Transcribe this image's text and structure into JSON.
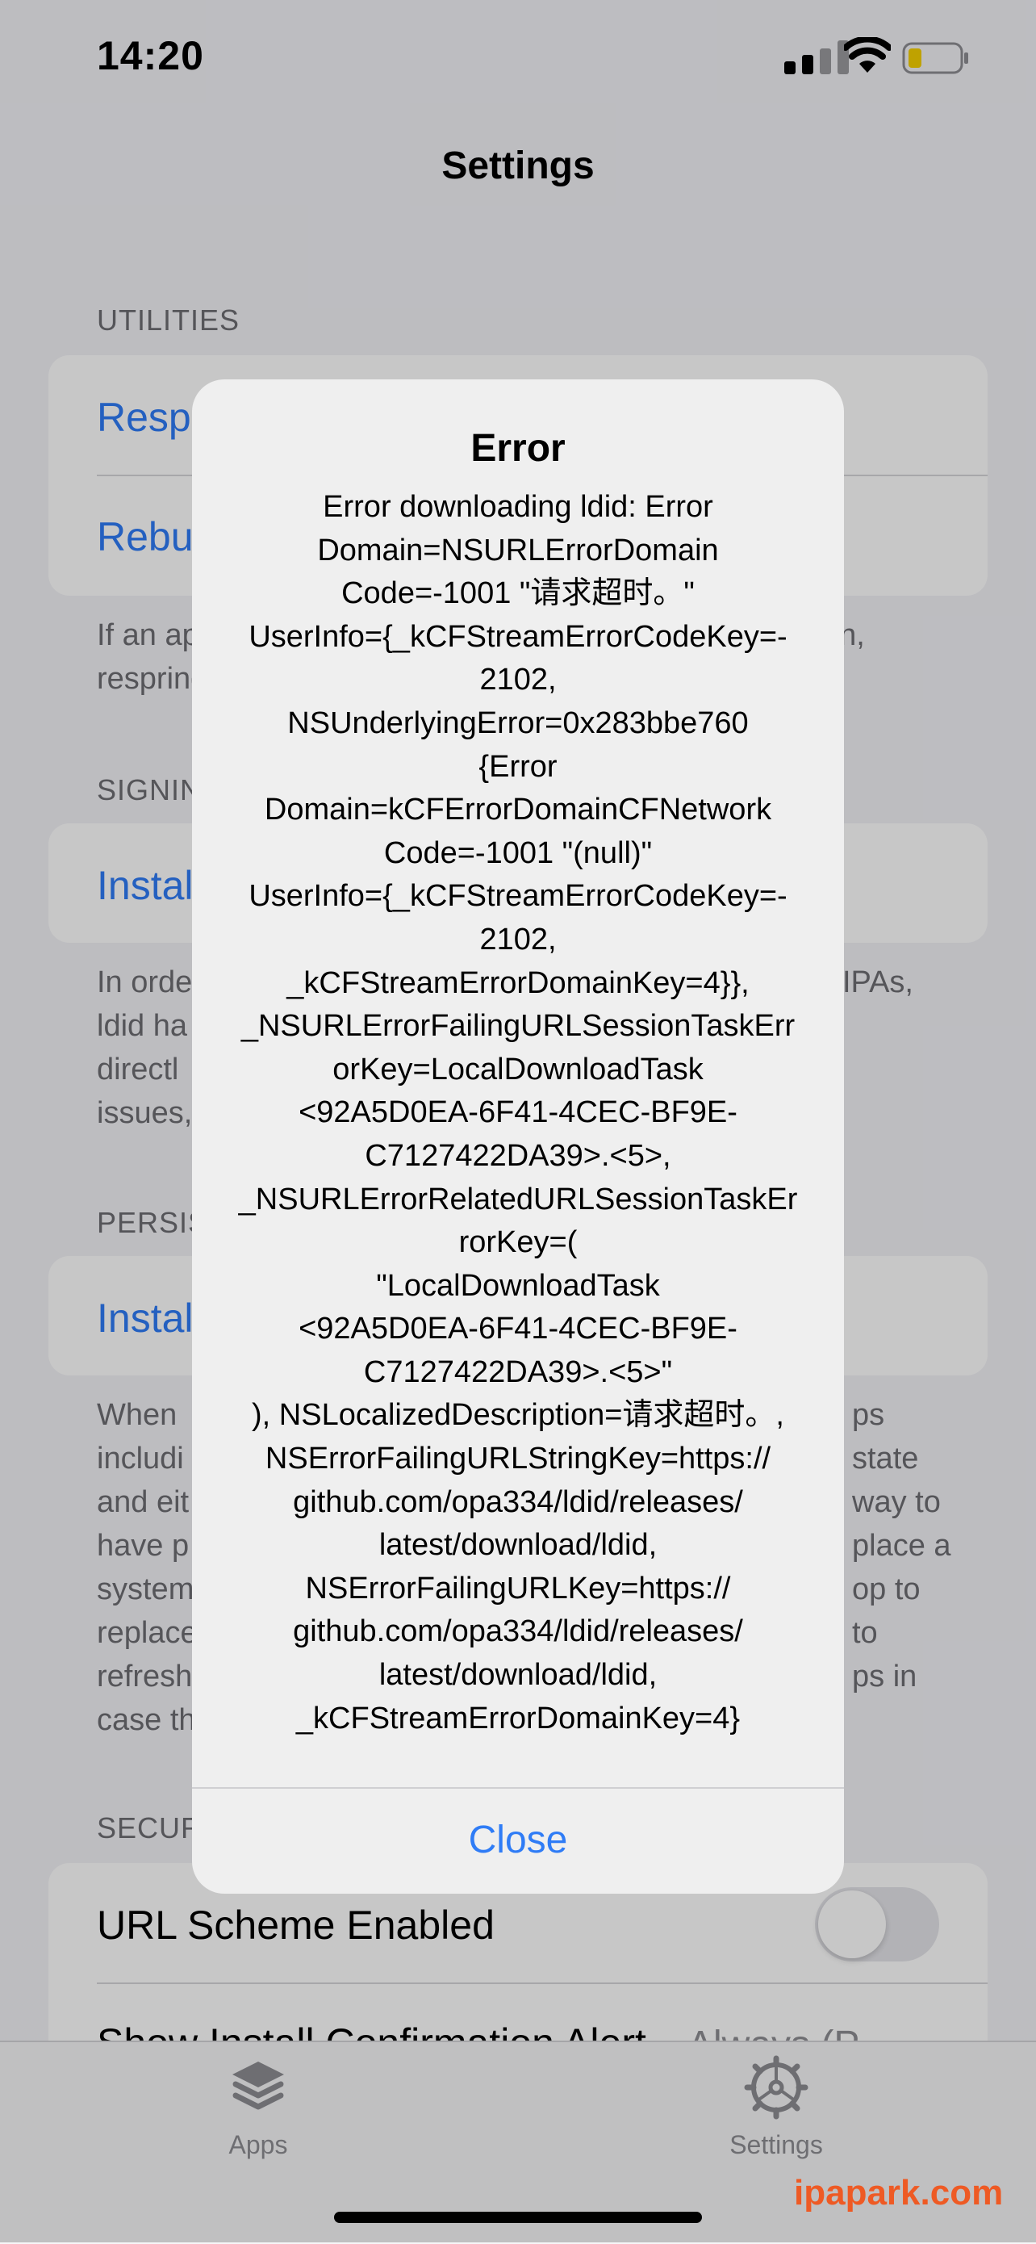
{
  "status_bar": {
    "time": "14:20"
  },
  "nav": {
    "title": "Settings"
  },
  "sections": {
    "utilities": {
      "header": "UTILITIES",
      "row1": "Resp",
      "row2": "Rebu",
      "footer_lines": [
        "If an ap",
        "respring"
      ]
    },
    "signing": {
      "header": "SIGNIN",
      "row1": "Instal",
      "footer_lines": [
        "In orde",
        "ldid ha",
        "directl",
        "issues,"
      ]
    },
    "persistence": {
      "header": "PERSIS",
      "row1": "Instal",
      "footer_lines": [
        "When",
        "includi",
        "and eit",
        "have p",
        "system",
        "replace",
        "refresh",
        "case th"
      ]
    },
    "security": {
      "header": "SECUR",
      "url_scheme_label": "URL Scheme Enabled",
      "url_scheme_enabled": false,
      "show_install_label": "Show Install Confirmation Alert",
      "show_install_value": "Always (P..."
    }
  },
  "right_fragments": {
    "r1": "tion,",
    "r2": "IPAs,",
    "r3": "ps",
    "r4": "state",
    "r5": "way to",
    "r6": "place a",
    "r7": "op to",
    "r8": "to",
    "r9": "ps in"
  },
  "alert": {
    "title": "Error",
    "message": "Error downloading ldid: Error\nDomain=NSURLErrorDomain\nCode=-1001 \"请求超时。\"\nUserInfo={_kCFStreamErrorCodeKey=-\n2102,\nNSUnderlyingError=0x283bbe760\n{Error\nDomain=kCFErrorDomainCFNetwork\nCode=-1001 \"(null)\"\nUserInfo={_kCFStreamErrorCodeKey=-\n2102,\n_kCFStreamErrorDomainKey=4}},\n_NSURLErrorFailingURLSessionTaskErr\norKey=LocalDownloadTask\n<92A5D0EA-6F41-4CEC-BF9E-\nC7127422DA39>.<5>,\n_NSURLErrorRelatedURLSessionTaskEr\nrorKey=(\n    \"LocalDownloadTask\n<92A5D0EA-6F41-4CEC-BF9E-\nC7127422DA39>.<5>\"\n), NSLocalizedDescription=请求超时。,\nNSErrorFailingURLStringKey=https://\ngithub.com/opa334/ldid/releases/\nlatest/download/ldid,\nNSErrorFailingURLKey=https://\ngithub.com/opa334/ldid/releases/\nlatest/download/ldid,\n_kCFStreamErrorDomainKey=4}",
    "button": "Close"
  },
  "tabbar": {
    "tabs": [
      {
        "label": "Apps",
        "icon": "layers-icon"
      },
      {
        "label": "Settings",
        "icon": "gear-icon"
      }
    ]
  },
  "watermark": "ipapark.com",
  "colors": {
    "accent": "#2f7cf6",
    "background": "#f2f2f7",
    "battery_fill": "#f5d000"
  }
}
